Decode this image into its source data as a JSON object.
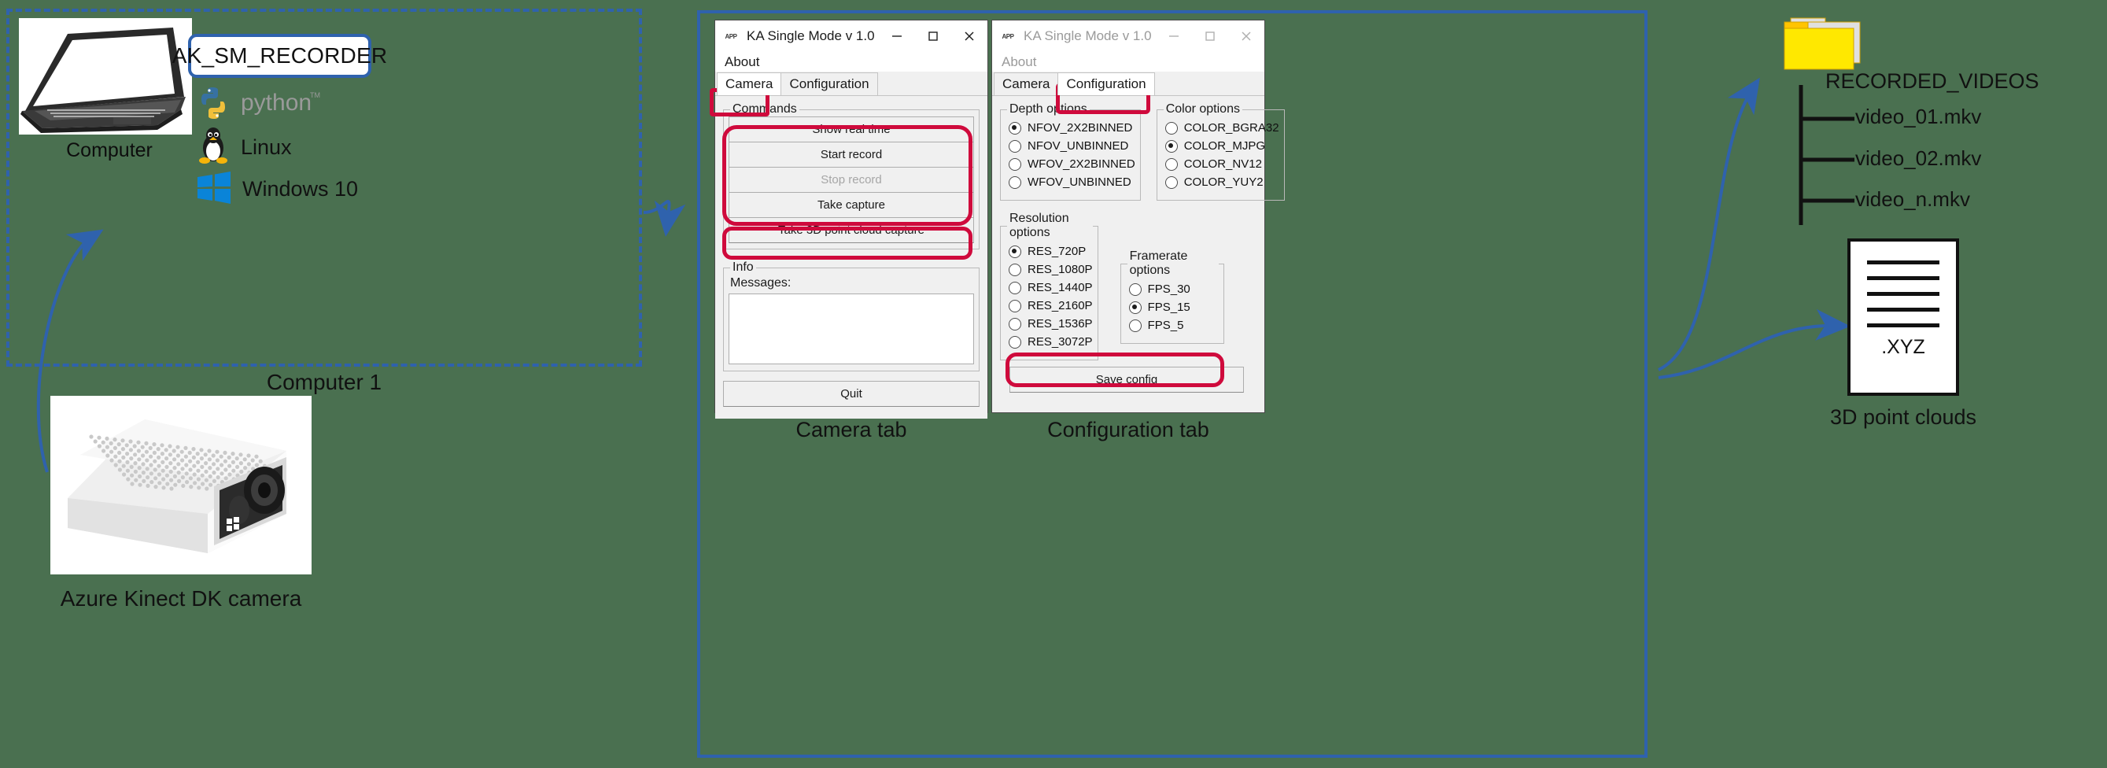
{
  "left_panel": {
    "computer_caption": "Computer",
    "app_badge": "AK_SM_RECORDER",
    "os_items": [
      {
        "icon": "python-logo-icon",
        "label": ""
      },
      {
        "icon": "linux-penguin-icon",
        "label": "Linux"
      },
      {
        "icon": "windows-logo-icon",
        "label": "Windows 10"
      }
    ],
    "group_caption": "Computer 1",
    "camera_caption": "Azure Kinect DK camera"
  },
  "camera_window": {
    "title": "KA Single Mode v 1.0",
    "app_icon": "app-icon",
    "window_buttons": {
      "minimize": "—",
      "maximize": "☐",
      "close": "✕"
    },
    "menu": [
      "About"
    ],
    "tabs": [
      {
        "label": "Camera",
        "active": true
      },
      {
        "label": "Configuration",
        "active": false
      }
    ],
    "commands_group": "Commands",
    "buttons": [
      {
        "label": "Show real time",
        "disabled": false
      },
      {
        "label": "Start record",
        "disabled": false
      },
      {
        "label": "Stop record",
        "disabled": true
      },
      {
        "label": "Take capture",
        "disabled": false
      },
      {
        "label": "Take 3D point cloud capture",
        "disabled": false
      }
    ],
    "info_group": "Info",
    "messages_label": "Messages:",
    "messages_value": "",
    "quit_label": "Quit",
    "caption": "Camera tab"
  },
  "config_window": {
    "title": "KA Single Mode v 1.0",
    "app_icon": "app-icon",
    "window_buttons": {
      "minimize": "—",
      "maximize": "☐",
      "close": "✕"
    },
    "menu": [
      "About"
    ],
    "tabs": [
      {
        "label": "Camera",
        "active": false
      },
      {
        "label": "Configuration",
        "active": true
      }
    ],
    "depth_group": "Depth options",
    "depth_options": [
      {
        "label": "NFOV_2X2BINNED",
        "checked": true
      },
      {
        "label": "NFOV_UNBINNED",
        "checked": false
      },
      {
        "label": "WFOV_2X2BINNED",
        "checked": false
      },
      {
        "label": "WFOV_UNBINNED",
        "checked": false
      }
    ],
    "color_group": "Color options",
    "color_options": [
      {
        "label": "COLOR_BGRA32",
        "checked": false
      },
      {
        "label": "COLOR_MJPG",
        "checked": true
      },
      {
        "label": "COLOR_NV12",
        "checked": false
      },
      {
        "label": "COLOR_YUY2",
        "checked": false
      }
    ],
    "resolution_group": "Resolution options",
    "resolution_options": [
      {
        "label": "RES_720P",
        "checked": true
      },
      {
        "label": "RES_1080P",
        "checked": false
      },
      {
        "label": "RES_1440P",
        "checked": false
      },
      {
        "label": "RES_2160P",
        "checked": false
      },
      {
        "label": "RES_1536P",
        "checked": false
      },
      {
        "label": "RES_3072P",
        "checked": false
      }
    ],
    "framerate_group": "Framerate options",
    "framerate_options": [
      {
        "label": "FPS_30",
        "checked": false
      },
      {
        "label": "FPS_15",
        "checked": true
      },
      {
        "label": "FPS_5",
        "checked": false
      }
    ],
    "save_label": "Save config",
    "caption": "Configuration tab"
  },
  "right_panel": {
    "folder_icon": "folder-icon",
    "folder_name": "RECORDED_VIDEOS",
    "files": [
      "video_01.mkv",
      "video_02.mkv",
      "video_n.mkv"
    ],
    "document_label": ".XYZ",
    "document_caption": "3D point clouds"
  },
  "colors": {
    "highlight": "#cf0a3c",
    "accent_blue": "#2f62ad",
    "background": "#4a7050",
    "folder_yellow": "#ffe800"
  }
}
